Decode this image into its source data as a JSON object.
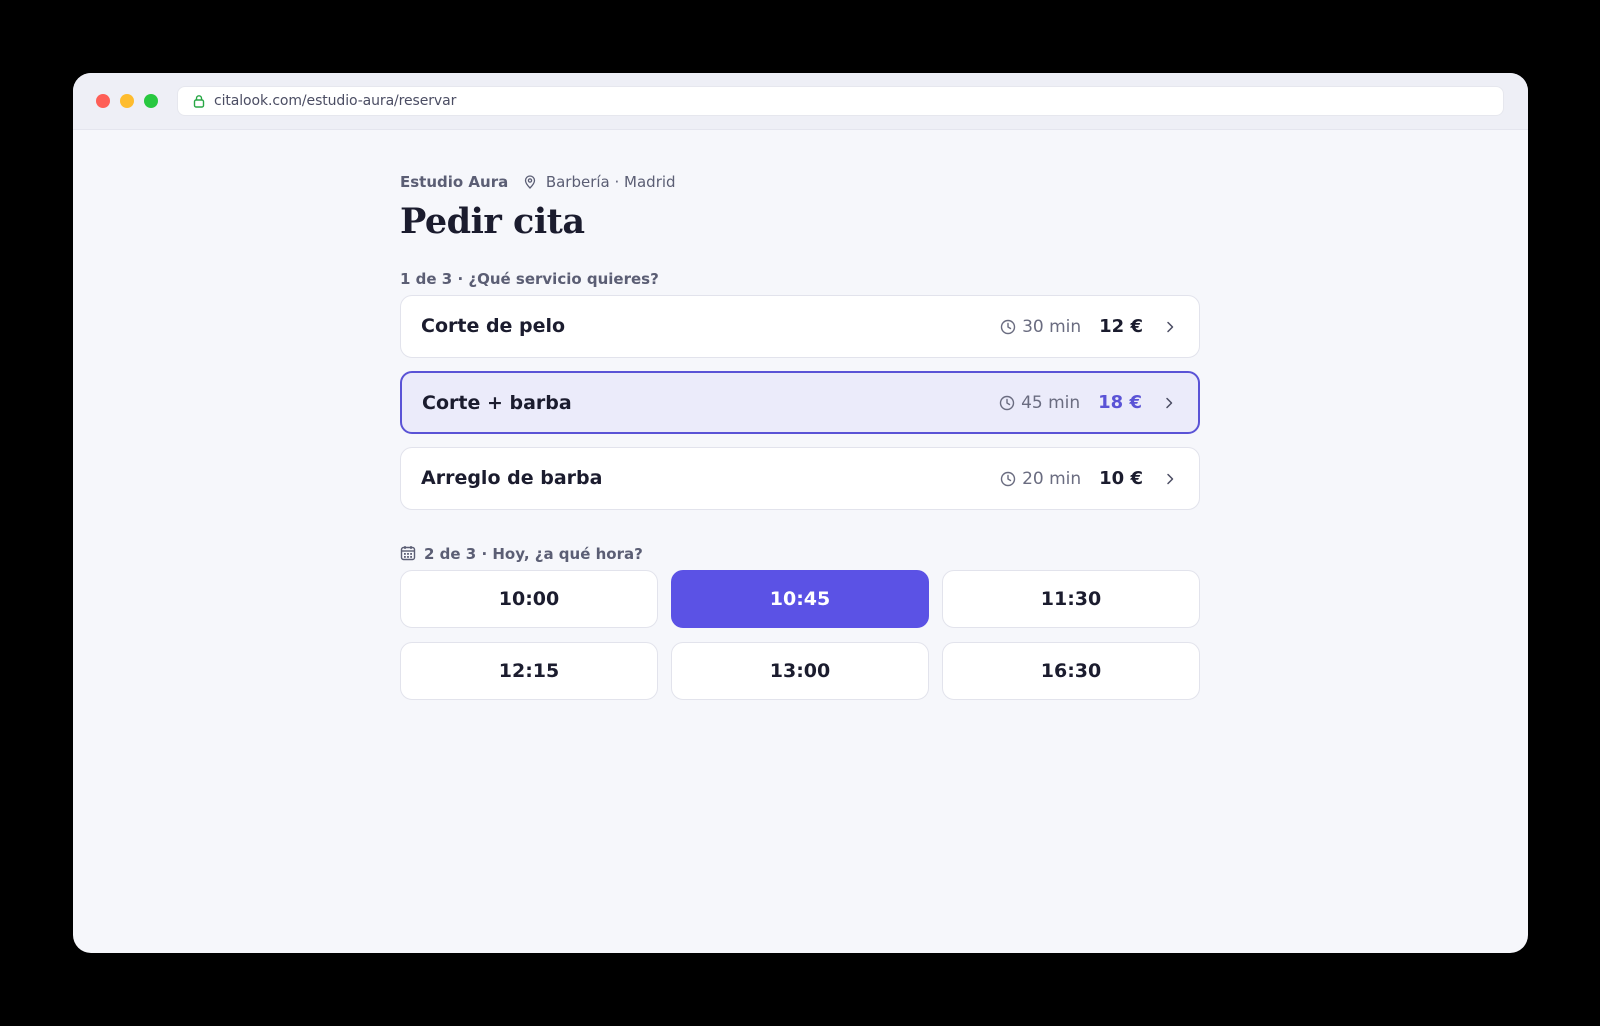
{
  "browser": {
    "url": "citalook.com/estudio-aura/reservar"
  },
  "business": {
    "name": "Estudio Aura",
    "category_location": "Barbería · Madrid"
  },
  "page": {
    "title": "Pedir cita"
  },
  "step1": {
    "label": "1 de 3 · ¿Qué servicio quieres?",
    "services": [
      {
        "name": "Corte de pelo",
        "duration": "30 min",
        "price": "12 €",
        "selected": false
      },
      {
        "name": "Corte + barba",
        "duration": "45 min",
        "price": "18 €",
        "selected": true
      },
      {
        "name": "Arreglo de barba",
        "duration": "20 min",
        "price": "10 €",
        "selected": false
      }
    ]
  },
  "step2": {
    "label": "2 de 3 · Hoy, ¿a qué hora?",
    "slots": [
      {
        "time": "10:00",
        "selected": false
      },
      {
        "time": "10:45",
        "selected": true
      },
      {
        "time": "11:30",
        "selected": false
      },
      {
        "time": "12:15",
        "selected": false
      },
      {
        "time": "13:00",
        "selected": false
      },
      {
        "time": "16:30",
        "selected": false
      }
    ]
  },
  "colors": {
    "accent": "#5b52e5",
    "selected_service_bg": "#ebebfa",
    "lock_green": "#28a745"
  },
  "icons": {
    "lock": "lock-icon",
    "pin": "map-pin-icon",
    "clock": "clock-icon",
    "chevron": "chevron-right-icon",
    "calendar": "calendar-icon"
  }
}
